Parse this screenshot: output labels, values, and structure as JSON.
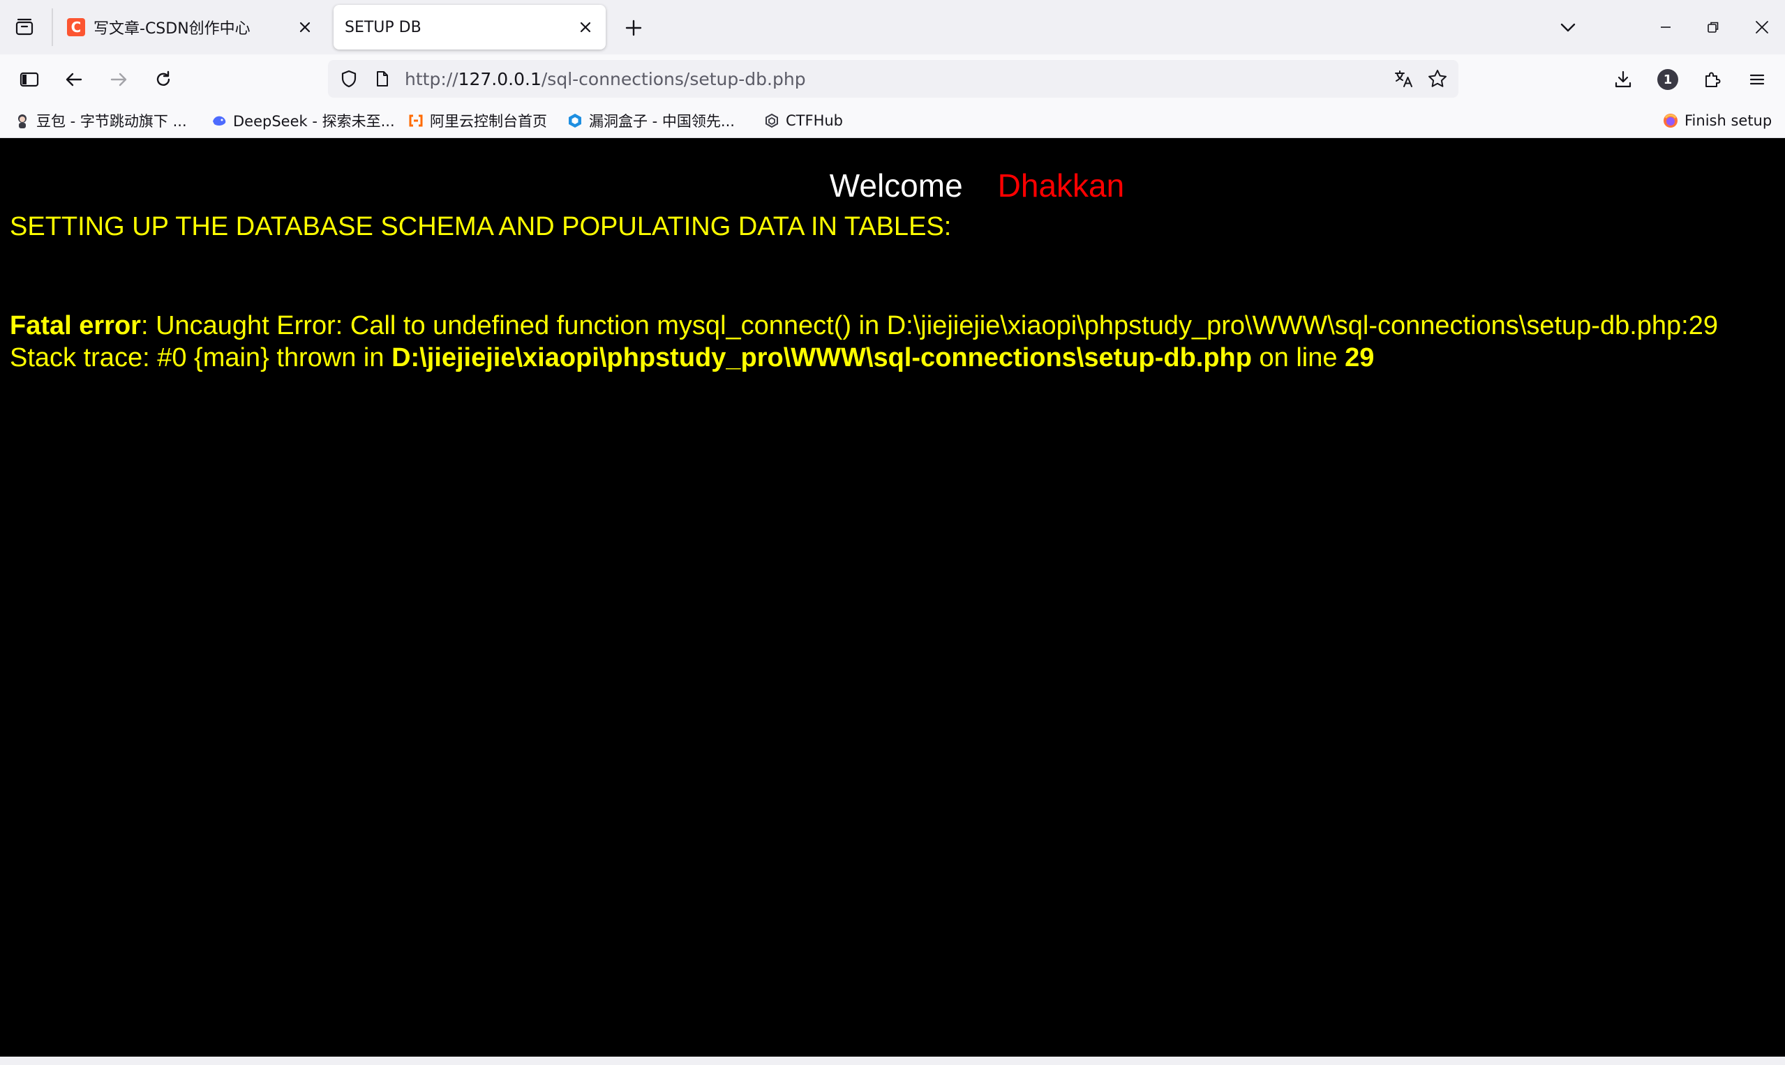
{
  "tabs": [
    {
      "title": "写文章-CSDN创作中心",
      "favicon_letter": "C",
      "active": false
    },
    {
      "title": "SETUP DB",
      "active": true
    }
  ],
  "navbar": {
    "url_scheme": "http://",
    "url_host": "127.0.0.1",
    "url_path": "/sql-connections/setup-db.php",
    "account_badge": "1"
  },
  "bookmarks": [
    {
      "label": "豆包 - 字节跳动旗下 ...",
      "icon": "doubao-icon"
    },
    {
      "label": "DeepSeek - 探索未至...",
      "icon": "deepseek-icon"
    },
    {
      "label": "阿里云控制台首页",
      "icon": "aliyun-icon"
    },
    {
      "label": "漏洞盒子 - 中国领先...",
      "icon": "vulbox-icon"
    },
    {
      "label": "CTFHub",
      "icon": "ctfhub-icon"
    }
  ],
  "finish_setup": "Finish setup",
  "page": {
    "welcome": "Welcome",
    "user": "Dhakkan",
    "heading": "SETTING UP THE DATABASE SCHEMA AND POPULATING DATA IN TABLES:",
    "error_label": "Fatal error",
    "error_message": ": Uncaught Error: Call to undefined function mysql_connect() in D:\\jiejiejie\\xiaopi\\phpstudy_pro\\WWW\\sql-connections\\setup-db.php:29 Stack trace: #0 {main} thrown in ",
    "error_file": "D:\\jiejiejie\\xiaopi\\phpstudy_pro\\WWW\\sql-connections\\setup-db.php",
    "error_on_line": " on line ",
    "error_line": "29"
  },
  "colors": {
    "welcome": "#ffffff",
    "user": "#ff0000",
    "text": "#ffff00",
    "background": "#000000"
  }
}
